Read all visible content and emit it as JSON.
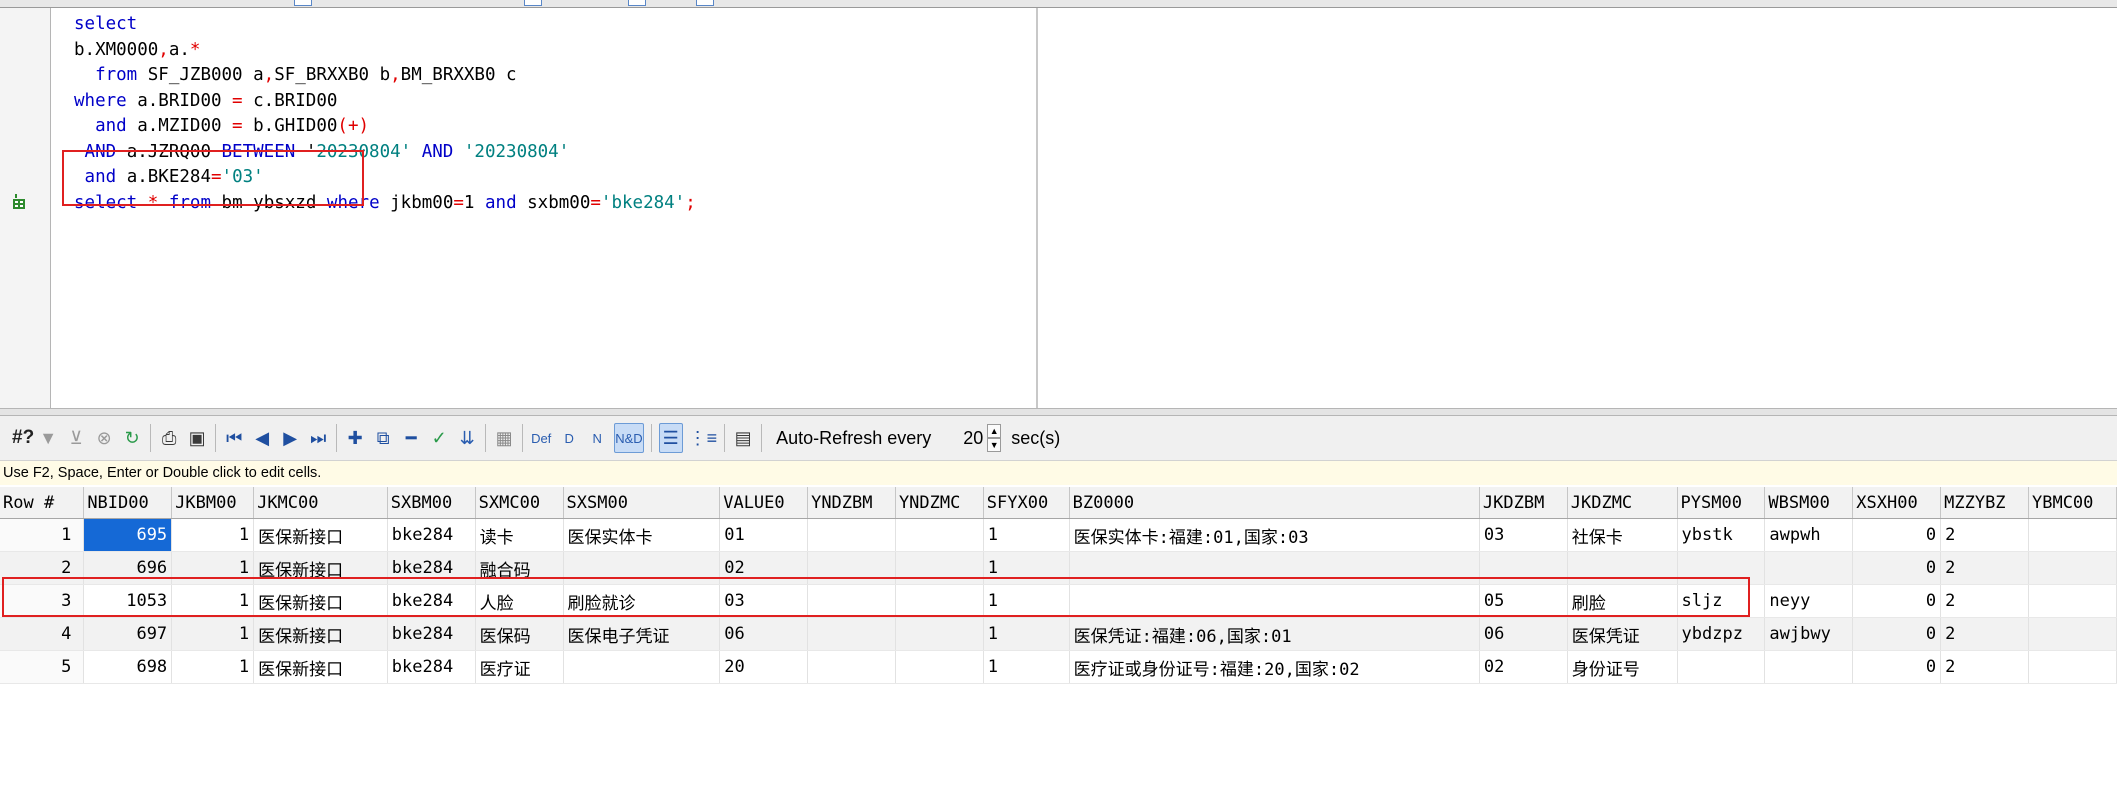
{
  "editor": {
    "lines": [
      {
        "indent": 0,
        "tokens": [
          {
            "t": "select",
            "c": "kw"
          }
        ]
      },
      {
        "indent": 0,
        "tokens": [
          {
            "t": "b.XM0000",
            "c": ""
          },
          {
            "t": ",",
            "c": "op"
          },
          {
            "t": "a.",
            "c": ""
          },
          {
            "t": "*",
            "c": "op"
          }
        ]
      },
      {
        "indent": 2,
        "tokens": [
          {
            "t": "from",
            "c": "kw"
          },
          {
            "t": " SF_JZB000 a",
            "c": ""
          },
          {
            "t": ",",
            "c": "op"
          },
          {
            "t": "SF_BRXXB0 b",
            "c": ""
          },
          {
            "t": ",",
            "c": "op"
          },
          {
            "t": "BM_BRXXB0 c",
            "c": ""
          }
        ]
      },
      {
        "indent": 0,
        "tokens": [
          {
            "t": "where",
            "c": "kw"
          },
          {
            "t": " a.BRID00 ",
            "c": ""
          },
          {
            "t": "=",
            "c": "op"
          },
          {
            "t": " c.BRID00",
            "c": ""
          }
        ]
      },
      {
        "indent": 2,
        "tokens": [
          {
            "t": "and",
            "c": "kw"
          },
          {
            "t": " a.MZID00 ",
            "c": ""
          },
          {
            "t": "=",
            "c": "op"
          },
          {
            "t": " b.GHID00",
            "c": ""
          },
          {
            "t": "(+)",
            "c": "op"
          }
        ]
      },
      {
        "indent": 1,
        "tokens": [
          {
            "t": "AND",
            "c": "kw strike"
          },
          {
            "t": " a.JZRQ00 ",
            "c": "strike"
          },
          {
            "t": "BETWEEN",
            "c": "kw strike"
          },
          {
            "t": " '",
            "c": ""
          },
          {
            "t": "20230804'",
            "c": "str"
          },
          {
            "t": " ",
            "c": ""
          },
          {
            "t": "AND",
            "c": "kw"
          },
          {
            "t": " ",
            "c": ""
          },
          {
            "t": "'20230804'",
            "c": "str"
          }
        ]
      },
      {
        "indent": 1,
        "tokens": [
          {
            "t": "and",
            "c": "kw"
          },
          {
            "t": " a.BKE284",
            "c": ""
          },
          {
            "t": "=",
            "c": "op"
          },
          {
            "t": "'03'",
            "c": "str"
          }
        ]
      },
      {
        "indent": 0,
        "tokens": [
          {
            "t": "select",
            "c": "kw"
          },
          {
            "t": " ",
            "c": ""
          },
          {
            "t": "*",
            "c": "op"
          },
          {
            "t": " ",
            "c": ""
          },
          {
            "t": "from",
            "c": "kw"
          },
          {
            "t": " bm ybsxzd ",
            "c": ""
          },
          {
            "t": "where",
            "c": "kw"
          },
          {
            "t": " jkbm00",
            "c": ""
          },
          {
            "t": "=",
            "c": "op"
          },
          {
            "t": "1 ",
            "c": ""
          },
          {
            "t": "and",
            "c": "kw"
          },
          {
            "t": " sxbm00",
            "c": ""
          },
          {
            "t": "=",
            "c": "op"
          },
          {
            "t": "'bke284'",
            "c": "str"
          },
          {
            "t": ";",
            "c": "op"
          }
        ]
      }
    ]
  },
  "toolbar": {
    "count_label": "#?",
    "def_label": "Def",
    "d_label": "D",
    "n_label": "N",
    "nd_label": "N&D",
    "auto_refresh_label": "Auto-Refresh every",
    "auto_refresh_value": "20",
    "auto_refresh_unit": "sec(s)"
  },
  "hint": "Use F2, Space, Enter or Double click to edit cells.",
  "grid": {
    "columns": [
      "Row #",
      "NBID00",
      "JKBM00",
      "JKMC00",
      "SXBM00",
      "SXMC00",
      "SXSM00",
      "VALUE0",
      "YNDZBM",
      "YNDZMC",
      "SFYX00",
      "BZ0000",
      "JKDZBM",
      "JKDZMC",
      "PYSM00",
      "WBSM00",
      "XSXH00",
      "MZZYBZ",
      "YBMC00"
    ],
    "rows": [
      [
        "1",
        "695",
        "1",
        "医保新接口",
        "bke284",
        "读卡",
        "医保实体卡",
        "01",
        "",
        "",
        "1",
        "医保实体卡:福建:01,国家:03",
        "03",
        "社保卡",
        "ybstk",
        "awpwh",
        "0",
        "2",
        ""
      ],
      [
        "2",
        "696",
        "1",
        "医保新接口",
        "bke284",
        "融合码",
        "",
        "02",
        "",
        "",
        "1",
        "",
        "",
        "",
        "",
        "",
        "0",
        "2",
        ""
      ],
      [
        "3",
        "1053",
        "1",
        "医保新接口",
        "bke284",
        "人脸",
        "刷脸就诊",
        "03",
        "",
        "",
        "1",
        "",
        "05",
        "刷脸",
        "sljz",
        "neyy",
        "0",
        "2",
        ""
      ],
      [
        "4",
        "697",
        "1",
        "医保新接口",
        "bke284",
        "医保码",
        "医保电子凭证",
        "06",
        "",
        "",
        "1",
        "医保凭证:福建:06,国家:01",
        "06",
        "医保凭证",
        "ybdzpz",
        "awjbwy",
        "0",
        "2",
        ""
      ],
      [
        "5",
        "698",
        "1",
        "医保新接口",
        "bke284",
        "医疗证",
        "",
        "20",
        "",
        "",
        "1",
        "医疗证或身份证号:福建:20,国家:02",
        "02",
        "身份证号",
        "",
        "",
        "0",
        "2",
        ""
      ]
    ]
  }
}
